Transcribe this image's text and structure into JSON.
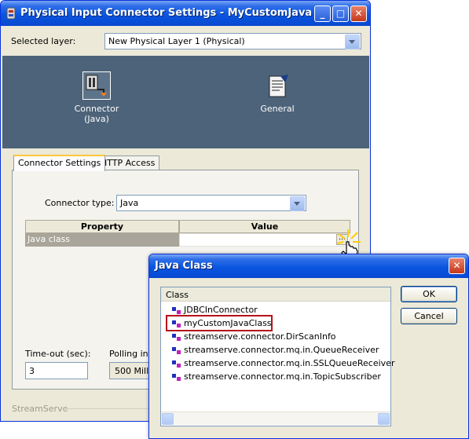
{
  "main_window": {
    "title": "Physical Input Connector Settings - MyCustomJava",
    "minimize": "_",
    "maximize": "□",
    "close": "✕",
    "selected_layer_label": "Selected layer:",
    "selected_layer_value": "New Physical Layer 1 (Physical)",
    "icons": [
      {
        "label_line1": "Connector",
        "label_line2": "(Java)",
        "icon": "connector-java-icon"
      },
      {
        "label_line1": "General",
        "label_line2": "",
        "icon": "general-settings-icon"
      }
    ],
    "tabs": [
      {
        "label": "Connector Settings",
        "active": true
      },
      {
        "label": "HTTP Access",
        "active": false
      }
    ],
    "connector_type_label": "Connector type:",
    "connector_type_value": "Java",
    "grid": {
      "headers": [
        "Property",
        "Value"
      ],
      "rows": [
        {
          "property": "Java class",
          "value": ""
        }
      ]
    },
    "timeout_label": "Time-out (sec):",
    "timeout_value": "3",
    "polling_label": "Polling inte",
    "polling_value": "500 Millis",
    "footer_brand": "StreamServe"
  },
  "dialog": {
    "title": "Java Class",
    "close": "✕",
    "list_header": "Class",
    "items": [
      "JDBCInConnector",
      "myCustomJavaClass",
      "streamserve.connector.DirScanInfo",
      "streamserve.connector.mq.in.QueueReceiver",
      "streamserve.connector.mq.in.SSLQueueReceiver",
      "streamserve.connector.mq.in.TopicSubscriber"
    ],
    "highlighted_item": "myCustomJavaClass",
    "ok_label": "OK",
    "cancel_label": "Cancel"
  },
  "colors": {
    "titlebar": "#0a55e0",
    "panel": "#4d6379",
    "highlight_box": "#b5121b"
  }
}
